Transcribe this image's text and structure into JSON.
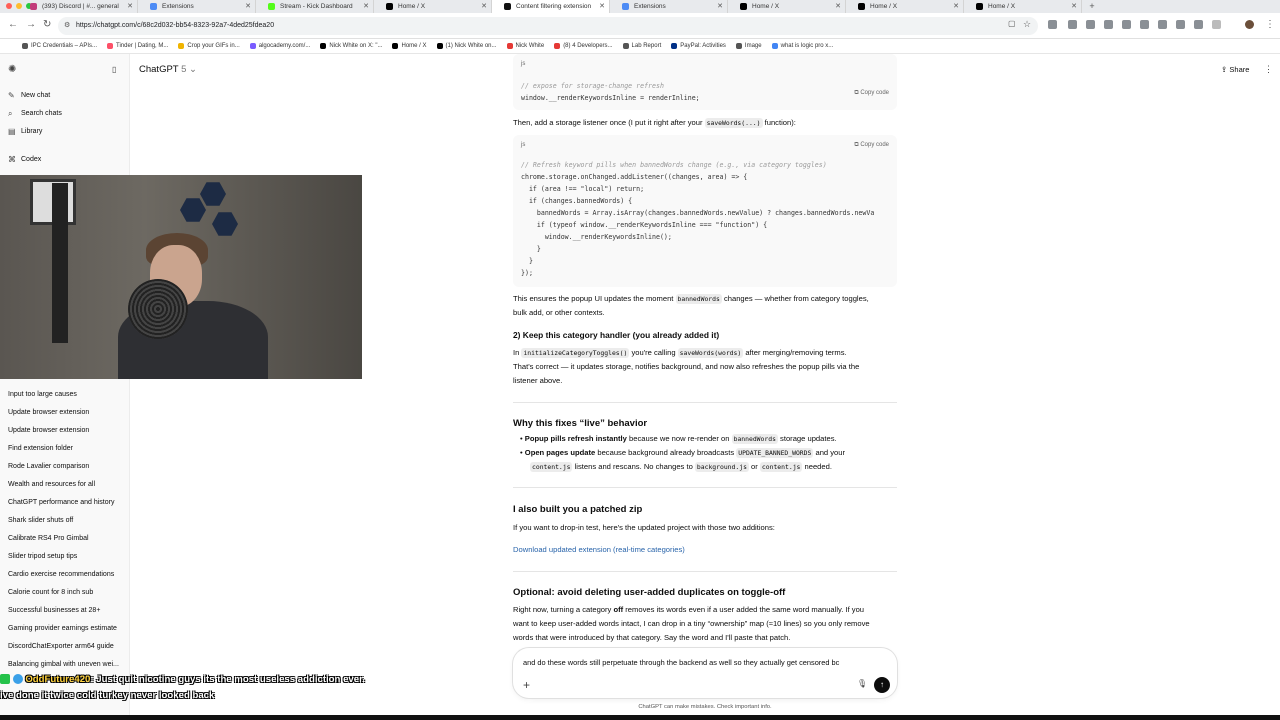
{
  "browser": {
    "tabs": [
      {
        "title": "(393) Discord | #... general",
        "color": "#c23b7a",
        "active": false
      },
      {
        "title": "Extensions",
        "color": "#4c8bf5",
        "active": false
      },
      {
        "title": "Stream - Kick Dashboard",
        "color": "#53fc18",
        "active": false
      },
      {
        "title": "Home / X",
        "color": "#000000",
        "active": false
      },
      {
        "title": "Content filtering extension",
        "color": "#111111",
        "active": true
      },
      {
        "title": "Extensions",
        "color": "#4c8bf5",
        "active": false
      },
      {
        "title": "Home / X",
        "color": "#000000",
        "active": false
      },
      {
        "title": "Home / X",
        "color": "#000000",
        "active": false
      },
      {
        "title": "Home / X",
        "color": "#000000",
        "active": false
      }
    ],
    "url": "https://chatgpt.com/c/68c2d032-bb54-8323-92a7-4ded25fdea20",
    "bookmarks": [
      {
        "label": "IPC Credentials – APIs...",
        "color": "#555555"
      },
      {
        "label": "Tinder | Dating, M...",
        "color": "#fd5068"
      },
      {
        "label": "Crop your GIFs in...",
        "color": "#f0b400"
      },
      {
        "label": "algocademy.com/...",
        "color": "#7a5cff"
      },
      {
        "label": "Nick White on X: \"...",
        "color": "#000000"
      },
      {
        "label": "Home / X",
        "color": "#000000"
      },
      {
        "label": "(1) Nick White on...",
        "color": "#000000"
      },
      {
        "label": "Nick White",
        "color": "#e53935"
      },
      {
        "label": "(8) 4 Developers...",
        "color": "#e53935"
      },
      {
        "label": "Lab Report",
        "color": "#555555"
      },
      {
        "label": "PayPal: Activities",
        "color": "#003087"
      },
      {
        "label": "Image",
        "color": "#555555"
      },
      {
        "label": "what is logic pro x...",
        "color": "#4285f4"
      }
    ]
  },
  "app": {
    "model_name": "ChatGPT",
    "model_version": "5",
    "share_label": "Share"
  },
  "sidebar": {
    "top_items": [
      {
        "label": "New chat",
        "icon": "compose-icon"
      },
      {
        "label": "Search chats",
        "icon": "search-icon"
      },
      {
        "label": "Library",
        "icon": "library-icon"
      },
      {
        "label": "Codex",
        "icon": "codex-icon"
      }
    ],
    "history": [
      "Input too large causes",
      "Update browser extension",
      "Update browser extension",
      "Find extension folder",
      "Rode Lavalier comparison",
      "Wealth and resources for all",
      "ChatGPT performance and history",
      "Shark slider shuts off",
      "Calibrate RS4 Pro Gimbal",
      "Slider tripod setup tips",
      "Cardio exercise recommendations",
      "Calorie count for 8 inch sub",
      "Successful businesses at 28+",
      "Gaming provider earnings estimate",
      "DiscordChatExporter arm64 guide",
      "Balancing gimbal with uneven wei..."
    ]
  },
  "message": {
    "code1": {
      "lang": "js",
      "copy": "Copy code",
      "comment": "// expose for storage-change refresh",
      "line": "window.__renderKeywordsInline = renderInline;"
    },
    "para1_a": "Then, add a storage listener once (I put it right after your ",
    "para1_code": "saveWords(...)",
    "para1_b": " function):",
    "code2": {
      "lang": "js",
      "copy": "Copy code",
      "lines": [
        "// Refresh keyword pills when bannedWords change (e.g., via category toggles)",
        "chrome.storage.onChanged.addListener((changes, area) => {",
        "  if (area !== \"local\") return;",
        "  if (changes.bannedWords) {",
        "    bannedWords = Array.isArray(changes.bannedWords.newValue) ? changes.bannedWords.newVa",
        "    if (typeof window.__renderKeywordsInline === \"function\") {",
        "      window.__renderKeywordsInline();",
        "    }",
        "  }",
        "});"
      ]
    },
    "para2_a": "This ensures the popup UI updates the moment ",
    "para2_code": "bannedWords",
    "para2_b": " changes — whether from category toggles,",
    "para2_c": "bulk add, or other contexts.",
    "heading2": "2) Keep this category handler (you already added it)",
    "para3_a": "In ",
    "para3_code1": "initializeCategoryToggles()",
    "para3_b": " you're calling ",
    "para3_code2": "saveWords(words)",
    "para3_c": " after merging/removing terms.",
    "para3_d": "That's correct — it updates storage, notifies background, and now also refreshes the popup pills via the",
    "para3_e": "listener above.",
    "heading3": "Why this fixes “live” behavior",
    "bullet1_bold": "Popup pills refresh instantly",
    "bullet1_a": " because we now re-render on ",
    "bullet1_code": "bannedWords",
    "bullet1_b": " storage updates.",
    "bullet2_bold": "Open pages update",
    "bullet2_a": " because background already broadcasts ",
    "bullet2_code": "UPDATE_BANNED_WORDS",
    "bullet2_b": " and your",
    "bullet2_code2": "content.js",
    "bullet2_c": " listens and rescans. No changes to ",
    "bullet2_code3": "background.js",
    "bullet2_d": " or ",
    "bullet2_code4": "content.js",
    "bullet2_e": " needed.",
    "heading4": "I also built you a patched zip",
    "para4": "If you want to drop-in test, here's the updated project with those two additions:",
    "download_link": "Download updated extension (real-time categories)",
    "heading5": "Optional: avoid deleting user-added duplicates on toggle-off",
    "para5_a": "Right now, turning a category ",
    "para5_bold": "off",
    "para5_b": " removes its words even if a user added the same word manually. If you",
    "para5_c": "want to keep user-added words intact, I can drop in a tiny “ownership” map (≈10 lines) so you only remove",
    "para5_d": "words that were introduced by that category. Say the word and I'll paste that patch."
  },
  "composer": {
    "text": "and do these words still perpetuate through the backend as well so they actually get censored bc",
    "disclaimer": "ChatGPT can make mistakes. Check important info."
  },
  "stream_chat": {
    "username": "OddFuture420",
    "line1": ": Just quit nicotine guys its the most useless addiction ever.",
    "line2": "ive done it twice cold turkey never looked back"
  }
}
